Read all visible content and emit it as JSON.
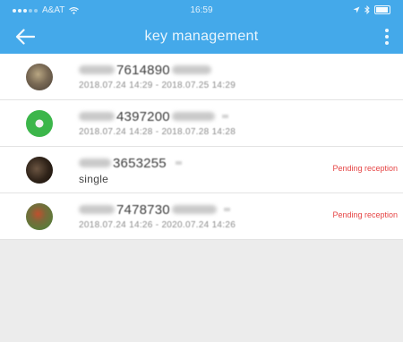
{
  "status_bar": {
    "carrier": "A&AT",
    "time": "16:59"
  },
  "nav": {
    "title": "key management",
    "back_icon": "arrow-left-icon",
    "more_icon": "more-vertical-icon"
  },
  "colors": {
    "header": "#44a9ea",
    "pending": "#e64545",
    "background": "#ececec"
  },
  "keys": [
    {
      "account_visible": "7614890",
      "period": "2018.07.24 14:29 - 2018.07.25 14:29",
      "status": "",
      "avatar_color": "#7a6a55"
    },
    {
      "account_visible": "4397200",
      "period": "2018.07.24 14:28 - 2018.07.28 14:28",
      "status": "",
      "avatar_color": "#3cb64a"
    },
    {
      "account_visible": "3653255",
      "period": "single",
      "status": "Pending reception",
      "avatar_color": "#2e2218"
    },
    {
      "account_visible": "7478730",
      "period": "2018.07.24 14:26 - 2020.07.24 14:26",
      "status": "Pending reception",
      "avatar_color": "#5d7a3a"
    }
  ]
}
